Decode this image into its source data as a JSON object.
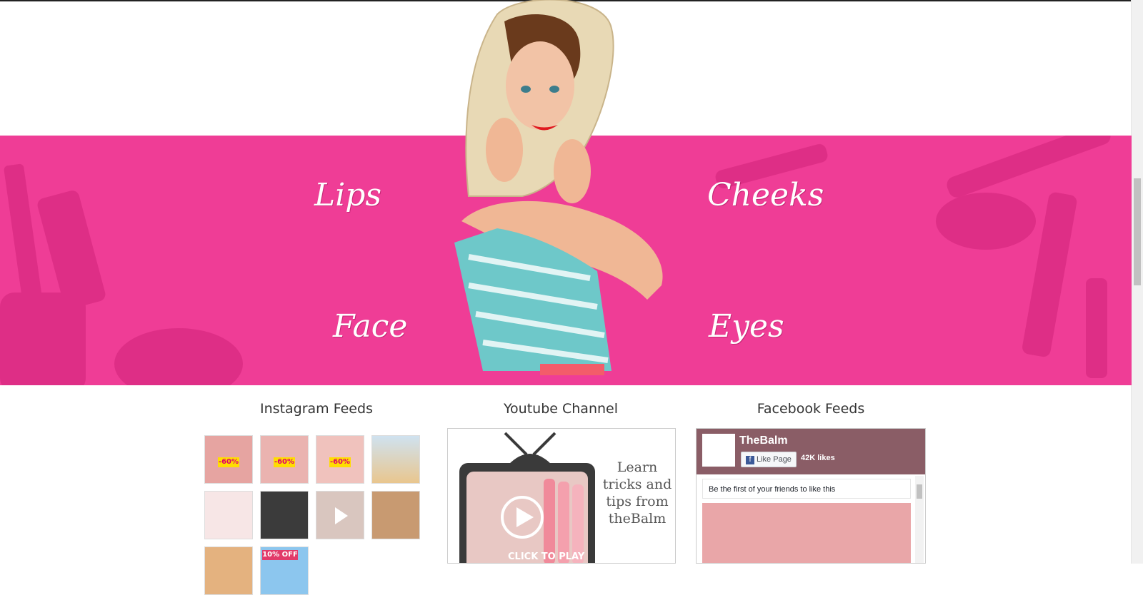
{
  "banner": {
    "categories": [
      "Lips",
      "Cheeks",
      "Face",
      "Eyes"
    ],
    "bg_color": "#ef3d96"
  },
  "sections": {
    "instagram_title": "Instagram Feeds",
    "youtube_title": "Youtube Channel",
    "facebook_title": "Facebook Feeds"
  },
  "instagram": {
    "tiles": [
      {
        "kind": "promo",
        "badge": "-60%"
      },
      {
        "kind": "promo",
        "badge": "-60%"
      },
      {
        "kind": "promo",
        "badge": "-60%"
      },
      {
        "kind": "image",
        "badge": ""
      },
      {
        "kind": "image",
        "badge": ""
      },
      {
        "kind": "image",
        "badge": ""
      },
      {
        "kind": "video",
        "badge": ""
      },
      {
        "kind": "image",
        "badge": ""
      },
      {
        "kind": "image",
        "badge": ""
      },
      {
        "kind": "promo",
        "badge": "10% OFF"
      }
    ]
  },
  "youtube": {
    "tagline": "Learn tricks and tips from theBalm",
    "cta": "CLICK TO PLAY"
  },
  "facebook": {
    "page_name": "TheBalm",
    "like_button": "Like Page",
    "likes_count": "42K likes",
    "friends_text": "Be the first of your friends to like this"
  },
  "colors": {
    "accent_pink": "#ef3d96",
    "text_dark": "#333333"
  }
}
